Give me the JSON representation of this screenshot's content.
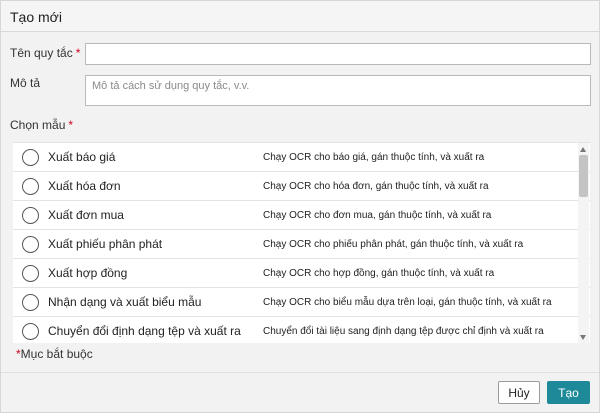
{
  "dialog": {
    "title": "Tạo mới",
    "name_label": "Tên quy tắc",
    "name_value": "",
    "description_label": "Mô tả",
    "description_placeholder": "Mô tả cách sử dụng quy tắc, v.v.",
    "template_label": "Chọn mẫu",
    "required_marker": "*",
    "required_note": "Mục bắt buộc",
    "cancel_label": "Hủy",
    "create_label": "Tạo",
    "accent_color": "#1e8a99"
  },
  "templates": [
    {
      "name": "Xuất báo giá",
      "description": "Chạy OCR cho báo giá, gán thuộc tính, và xuất ra"
    },
    {
      "name": "Xuất hóa đơn",
      "description": "Chạy OCR cho hóa đơn, gán thuộc tính, và xuất ra"
    },
    {
      "name": "Xuất đơn mua",
      "description": "Chạy OCR cho đơn mua, gán thuộc tính, và xuất ra"
    },
    {
      "name": "Xuất phiếu phân phát",
      "description": "Chạy OCR cho phiếu phân phát, gán thuộc tính, và xuất ra"
    },
    {
      "name": "Xuất hợp đồng",
      "description": "Chạy OCR cho hợp đồng, gán thuộc tính, và xuất ra"
    },
    {
      "name": "Nhận dạng và xuất biểu mẫu",
      "description": "Chạy OCR cho biểu mẫu dựa trên loại, gán thuộc tính, và xuất ra"
    },
    {
      "name": "Chuyển đổi định dạng tệp và xuất ra",
      "description": "Chuyển đổi tài liệu sang định dạng tệp được chỉ định và xuất ra"
    }
  ]
}
